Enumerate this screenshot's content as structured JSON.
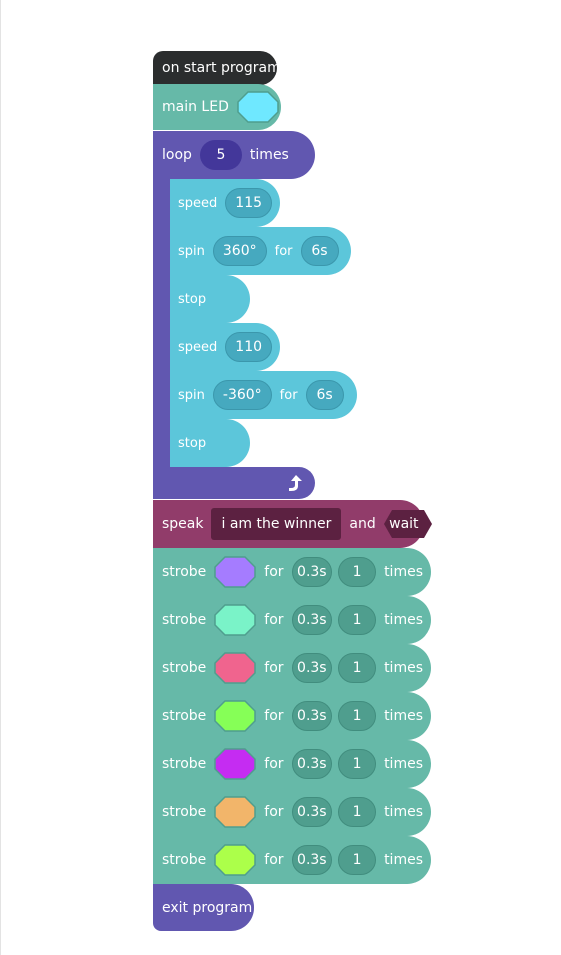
{
  "start": {
    "label": "on start program"
  },
  "main_led": {
    "label": "main LED",
    "color": "#6fe8ff"
  },
  "loop": {
    "label": "loop",
    "count": "5",
    "times": "times"
  },
  "inner": [
    {
      "kind": "speed",
      "label": "speed",
      "value": "115"
    },
    {
      "kind": "spin",
      "label": "spin",
      "angle": "360°",
      "for": "for",
      "dur": "6s"
    },
    {
      "kind": "stop",
      "label": "stop"
    },
    {
      "kind": "speed",
      "label": "speed",
      "value": "110"
    },
    {
      "kind": "spin",
      "label": "spin",
      "angle": "-360°",
      "for": "for",
      "dur": "6s"
    },
    {
      "kind": "stop",
      "label": "stop"
    }
  ],
  "loop_end": {
    "icon": "loop-return-arrow-icon"
  },
  "speak": {
    "label": "speak",
    "text": "i am the winner",
    "and": "and",
    "wait": "wait"
  },
  "strobes": [
    {
      "label": "strobe",
      "color": "#a57cff",
      "for": "for",
      "duration": "0.3s",
      "count": "1",
      "times": "times"
    },
    {
      "label": "strobe",
      "color": "#7af3c8",
      "for": "for",
      "duration": "0.3s",
      "count": "1",
      "times": "times"
    },
    {
      "label": "strobe",
      "color": "#f0648e",
      "for": "for",
      "duration": "0.3s",
      "count": "1",
      "times": "times"
    },
    {
      "label": "strobe",
      "color": "#86ff57",
      "for": "for",
      "duration": "0.3s",
      "count": "1",
      "times": "times"
    },
    {
      "label": "strobe",
      "color": "#c52cf2",
      "for": "for",
      "duration": "0.3s",
      "count": "1",
      "times": "times"
    },
    {
      "label": "strobe",
      "color": "#f2b56a",
      "for": "for",
      "duration": "0.3s",
      "count": "1",
      "times": "times"
    },
    {
      "label": "strobe",
      "color": "#acff4a",
      "for": "for",
      "duration": "0.3s",
      "count": "1",
      "times": "times"
    }
  ],
  "exit": {
    "label": "exit program"
  },
  "colors": {
    "teal": "#66b9a8",
    "teal_pill": "#4f9e8e",
    "purple": "#6157b0",
    "purple_pill": "#43379a",
    "cyan": "#5cc6da",
    "cyan_pill": "#46a9bf",
    "speak": "#913c6a",
    "speak_box": "#5c2141",
    "start": "#2b2d2e"
  }
}
